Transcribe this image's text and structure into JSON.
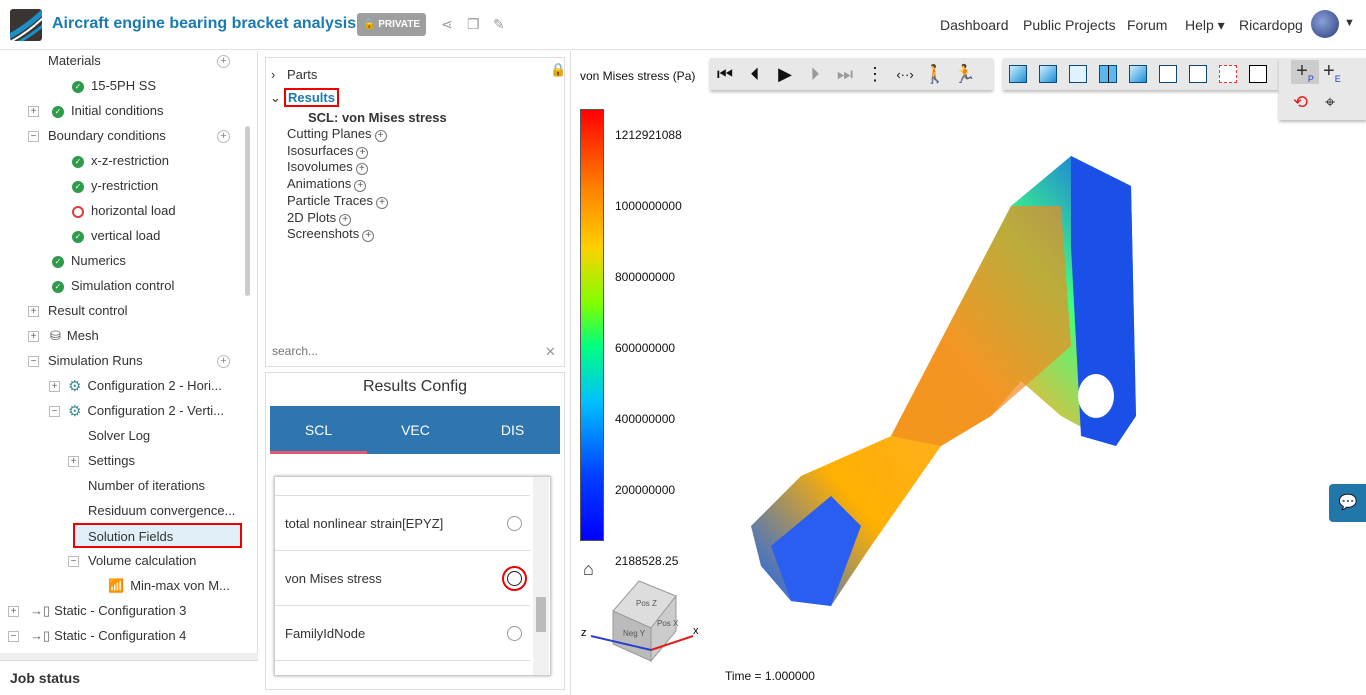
{
  "header": {
    "title": "Aircraft engine bearing bracket analysis",
    "private_label": "PRIVATE",
    "nav": [
      "Dashboard",
      "Public Projects",
      "Forum",
      "Help"
    ],
    "user": "Ricardopg"
  },
  "tree": [
    {
      "label": "Materials",
      "status": "none"
    },
    {
      "label": "15-5PH SS",
      "status": "ok"
    },
    {
      "label": "Initial conditions",
      "status": "ok"
    },
    {
      "label": "Boundary conditions",
      "status": "none"
    },
    {
      "label": "x-z-restriction",
      "status": "ok"
    },
    {
      "label": "y-restriction",
      "status": "ok"
    },
    {
      "label": "horizontal load",
      "status": "error"
    },
    {
      "label": "vertical load",
      "status": "ok"
    },
    {
      "label": "Numerics",
      "status": "ok"
    },
    {
      "label": "Simulation control",
      "status": "ok"
    },
    {
      "label": "Result control",
      "status": "none"
    },
    {
      "label": "Mesh",
      "status": "ok"
    },
    {
      "label": "Simulation Runs",
      "status": "none"
    },
    {
      "label": "Configuration 2 - Hori...",
      "status": "ok"
    },
    {
      "label": "Configuration 2 - Verti...",
      "status": "ok"
    },
    {
      "label": "Solver Log",
      "status": "none"
    },
    {
      "label": "Settings",
      "status": "none"
    },
    {
      "label": "Number of iterations",
      "status": "none"
    },
    {
      "label": "Residuum convergence...",
      "status": "none"
    },
    {
      "label": "Solution Fields",
      "status": "selected"
    },
    {
      "label": "Volume calculation",
      "status": "none"
    },
    {
      "label": "Min-max von M...",
      "status": "none"
    },
    {
      "label": "Static - Configuration 3",
      "status": "none"
    },
    {
      "label": "Static - Configuration 4",
      "status": "none"
    }
  ],
  "job_status": "Job status",
  "post_tree": {
    "parts": "Parts",
    "results": "Results",
    "scl": "SCL: von Mises stress",
    "items": [
      "Cutting Planes",
      "Isosurfaces",
      "Isovolumes",
      "Animations",
      "Particle Traces",
      "2D Plots",
      "Screenshots"
    ],
    "search_placeholder": "search..."
  },
  "results_config": {
    "title": "Results Config",
    "tabs": [
      "SCL",
      "VEC",
      "DIS"
    ],
    "fields": [
      "total nonlinear strain[EPYZ]",
      "von Mises stress",
      "FamilyIdNode"
    ]
  },
  "legend": {
    "title": "von Mises stress (Pa)",
    "ticks": [
      "1212921088",
      "1000000000",
      "800000000",
      "600000000",
      "400000000",
      "200000000",
      "2188528.25"
    ]
  },
  "viewer": {
    "time": "Time = 1.000000",
    "axes": [
      "z",
      "x"
    ],
    "cube_faces": [
      "Pos Z",
      "Pos X",
      "Neg Y"
    ]
  }
}
